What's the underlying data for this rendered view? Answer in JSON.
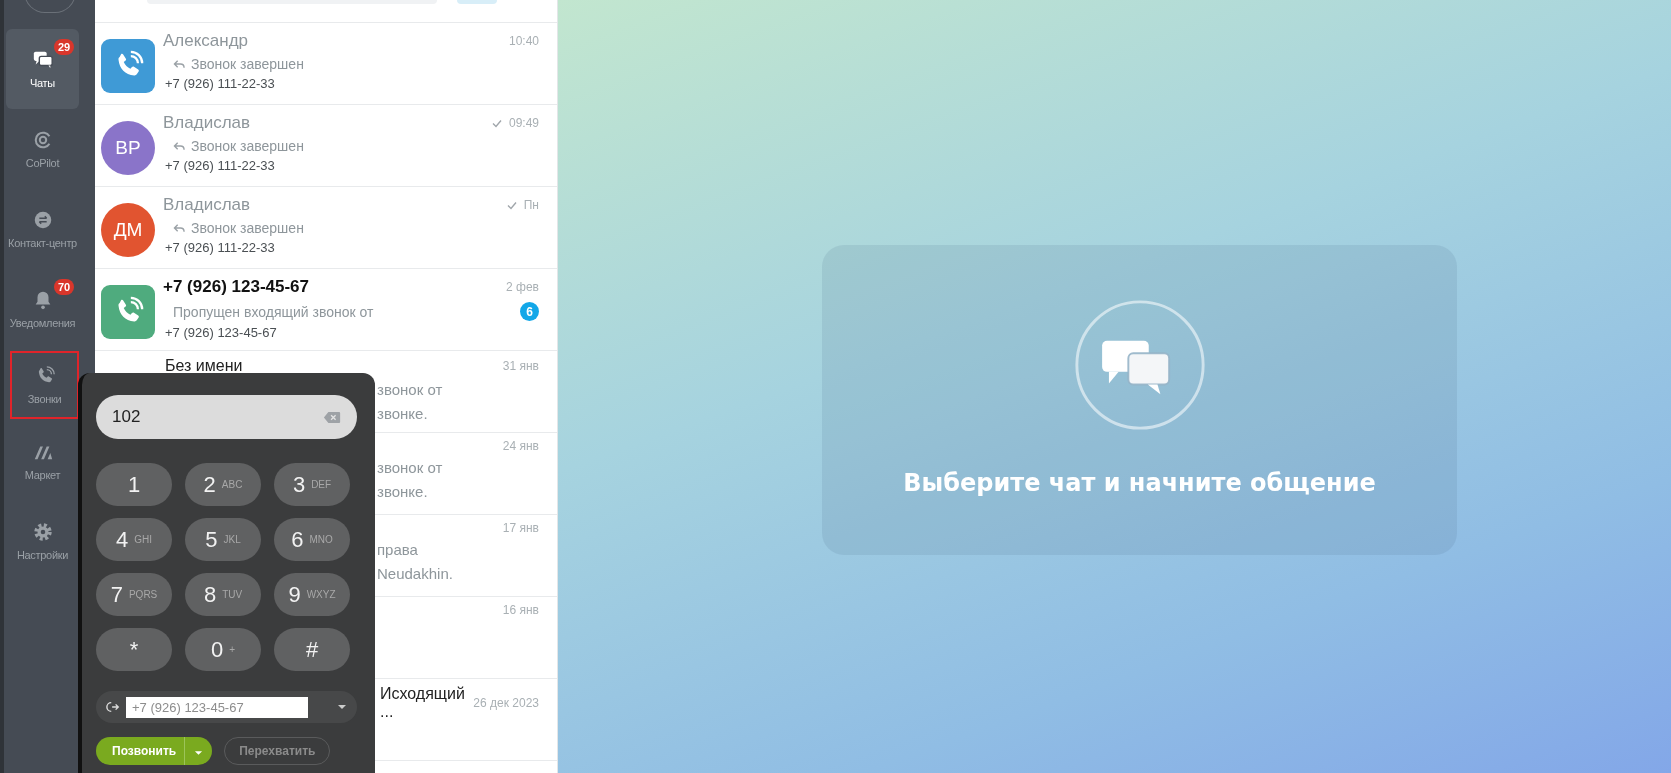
{
  "sidebar": {
    "items": [
      {
        "kind": "chats",
        "label": "Чаты",
        "badge": "29",
        "selected": true,
        "highlighted": false
      },
      {
        "kind": "copilot",
        "label": "CoPilot",
        "selected": false,
        "highlighted": false
      },
      {
        "kind": "contact_center",
        "label": "Контакт-центр",
        "selected": false,
        "highlighted": false
      },
      {
        "kind": "notifications",
        "label": "Уведомления",
        "badge": "70",
        "selected": false,
        "highlighted": false
      },
      {
        "kind": "calls",
        "label": "Звонки",
        "selected": false,
        "highlighted": true
      },
      {
        "kind": "market",
        "label": "Маркет",
        "selected": false,
        "highlighted": false
      },
      {
        "kind": "settings",
        "label": "Настройки",
        "selected": false,
        "highlighted": false
      }
    ]
  },
  "chats": [
    {
      "avatar": {
        "kind": "phone",
        "color": "#3f9ad6"
      },
      "name": "Александр",
      "unread": false,
      "read": false,
      "time": "10:40",
      "preview": "Звонок завершен",
      "reply_arrow": true,
      "number": "+7 (926) 111-22-33"
    },
    {
      "avatar": {
        "kind": "initials",
        "initials": "ВР",
        "color": "#8a74c9"
      },
      "name": "Владислав",
      "unread": false,
      "read": true,
      "time": "09:49",
      "preview": "Звонок завершен",
      "reply_arrow": true,
      "number": "+7 (926) 111-22-33"
    },
    {
      "avatar": {
        "kind": "initials",
        "initials": "ДМ",
        "color": "#e15430"
      },
      "name": "Владислав",
      "unread": false,
      "read": true,
      "time": "Пн",
      "preview": "Звонок завершен",
      "reply_arrow": true,
      "number": "+7 (926) 111-22-33"
    },
    {
      "avatar": {
        "kind": "phone",
        "color": "#4fab7e"
      },
      "name": "+7 (926) 123-45-67",
      "unread": true,
      "read": false,
      "time": "2 фев",
      "preview": "Пропущен входящий звонок от",
      "reply_arrow": false,
      "number": "+7 (926) 123-45-67",
      "badge": "6"
    }
  ],
  "covered_chats": [
    {
      "title": "Без имени",
      "time": "31 янв",
      "tails": [
        "звонок от",
        "звонке."
      ]
    },
    {
      "time": "24 янв",
      "tails": [
        "звонок от",
        "звонке."
      ]
    },
    {
      "time": "17 янв",
      "tails": [
        "права",
        "Neudakhin."
      ]
    },
    {
      "time": "16 янв"
    },
    {
      "title_tail": "Исходящий ...",
      "time": "26 дек 2023"
    }
  ],
  "dialer": {
    "value": "102",
    "keys": [
      {
        "digit": "1"
      },
      {
        "digit": "2",
        "letters": "ABC"
      },
      {
        "digit": "3",
        "letters": "DEF"
      },
      {
        "digit": "4",
        "letters": "GHI"
      },
      {
        "digit": "5",
        "letters": "JKL"
      },
      {
        "digit": "6",
        "letters": "MNO"
      },
      {
        "digit": "7",
        "letters": "PQRS"
      },
      {
        "digit": "8",
        "letters": "TUV"
      },
      {
        "digit": "9",
        "letters": "WXYZ"
      },
      {
        "digit": "*"
      },
      {
        "digit": "0",
        "letters": "+"
      },
      {
        "digit": "#"
      }
    ],
    "caller_id": "+7 (926) 123-45-67",
    "call_button": "Позвонить",
    "intercept_button": "Перехватить"
  },
  "empty_state": {
    "message": "Выберите чат и начните общение"
  }
}
